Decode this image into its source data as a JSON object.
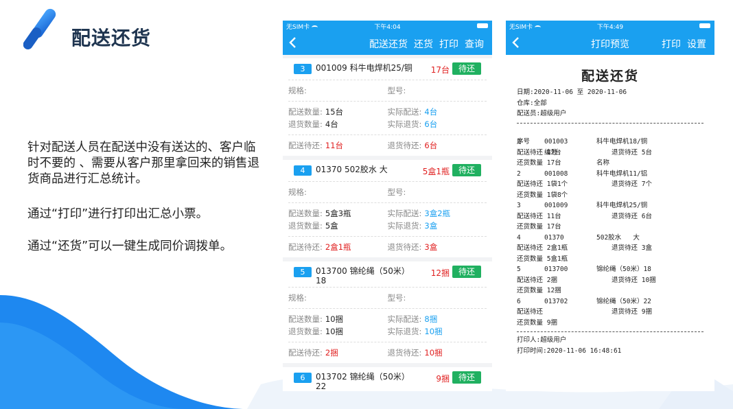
{
  "slide": {
    "title": "配送还货",
    "paragraphs": [
      "针对配送人员在配送中没有送达的、客户临时不要的 、需要从客户那里拿回来的销售退货商品进行汇总统计。",
      "通过“打印”进行打印出汇总小票。",
      "通过“还货”可以一键生成同价调拨单。"
    ]
  },
  "phone_a": {
    "carrier": "无SIM卡",
    "time": "下午4:04",
    "actions": [
      "配送还货",
      "还货",
      "打印",
      "查询"
    ],
    "labels": {
      "spec": "规格:",
      "model": "型号:",
      "deliver_qty": "配送数量:",
      "actual_deliver": "实际配送:",
      "return_qty": "退货数量:",
      "actual_return": "实际退货:",
      "deliver_pending": "配送待还:",
      "return_pending": "退货待还:",
      "tag": "待还"
    },
    "items": [
      {
        "index": "3",
        "name": "001009 科牛电焊机25/铜",
        "qty": "17台",
        "deliver": "15台",
        "actual_deliver": "4台",
        "return": "4台",
        "actual_return": "6台",
        "deliver_pending": "11台",
        "return_pending": "6台"
      },
      {
        "index": "4",
        "name": "01370 502胶水  大",
        "qty": "5盒1瓶",
        "deliver": "5盒3瓶",
        "actual_deliver": "3盒2瓶",
        "return": "5盒",
        "actual_return": "3盒",
        "deliver_pending": "2盒1瓶",
        "return_pending": "3盒"
      },
      {
        "index": "5",
        "name": "013700 锦纶绳（50米）18",
        "qty": "12捆",
        "deliver": "10捆",
        "actual_deliver": "8捆",
        "return": "10捆",
        "actual_return": "10捆",
        "deliver_pending": "2捆",
        "return_pending": "10捆"
      },
      {
        "index": "6",
        "name": "013702 锦纶绳（50米）22",
        "qty": "9捆"
      }
    ]
  },
  "phone_b": {
    "carrier": "无SIM卡",
    "time": "下午4:49",
    "title": "打印预览",
    "actions": [
      "打印",
      "设置"
    ],
    "receipt": {
      "title": "配送还货",
      "date": "日期:2020-11-06 至 2020-11-06",
      "warehouse": "仓库:全部",
      "staff": "配送员:超级用户",
      "header": {
        "no": "序号",
        "code": "编号",
        "name": "名称"
      },
      "rows": [
        {
          "no": "1",
          "code": "001003",
          "name": "科牛电焊机18/铜",
          "deliver": "配送待还 12台",
          "ret": "退货待还 5台",
          "retqty": "还货数量 17台"
        },
        {
          "no": "2",
          "code": "001008",
          "name": "科牛电焊机11/铝",
          "deliver": "配送待还 1袋1个",
          "ret": "退货待还 7个",
          "retqty": "还货数量 1袋8个"
        },
        {
          "no": "3",
          "code": "001009",
          "name": "科牛电焊机25/铜",
          "deliver": "配送待还 11台",
          "ret": "退货待还 6台",
          "retqty": "还货数量 17台"
        },
        {
          "no": "4",
          "code": "01370",
          "name": "502胶水   大",
          "deliver": "配送待还 2盒1瓶",
          "ret": "退货待还 3盒",
          "retqty": "还货数量 5盒1瓶"
        },
        {
          "no": "5",
          "code": "013700",
          "name": "锦纶绳（50米）18",
          "deliver": "配送待还 2捆",
          "ret": "退货待还 10捆",
          "retqty": "还货数量 12捆"
        },
        {
          "no": "6",
          "code": "013702",
          "name": "锦纶绳（50米）22",
          "deliver": "配送待还",
          "ret": "退货待还 9捆",
          "retqty": "还货数量 9捆"
        }
      ],
      "printer": "打印人:超级用户",
      "print_time": "打印时间:2020-11-06 16:48:61"
    }
  },
  "colors": {
    "accent": "#1aa0f0",
    "tag_green": "#20b060",
    "alert_red": "#e02020",
    "title_navy": "#1f3550"
  }
}
